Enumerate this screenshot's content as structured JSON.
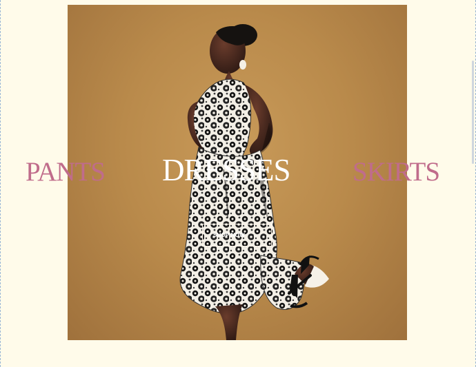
{
  "carousel": {
    "left_category": "PANTS",
    "center_category": "DRESSES",
    "right_category": "SKIRTS",
    "cta_label": "SHOP NOW",
    "arrow_glyph": "→",
    "arrow_icon": "arrow-right-icon"
  },
  "colors": {
    "page_background": "#fffbea",
    "side_category": "#c06c8b",
    "center_category": "#ffffff",
    "hero_background": "#b98a4b"
  }
}
